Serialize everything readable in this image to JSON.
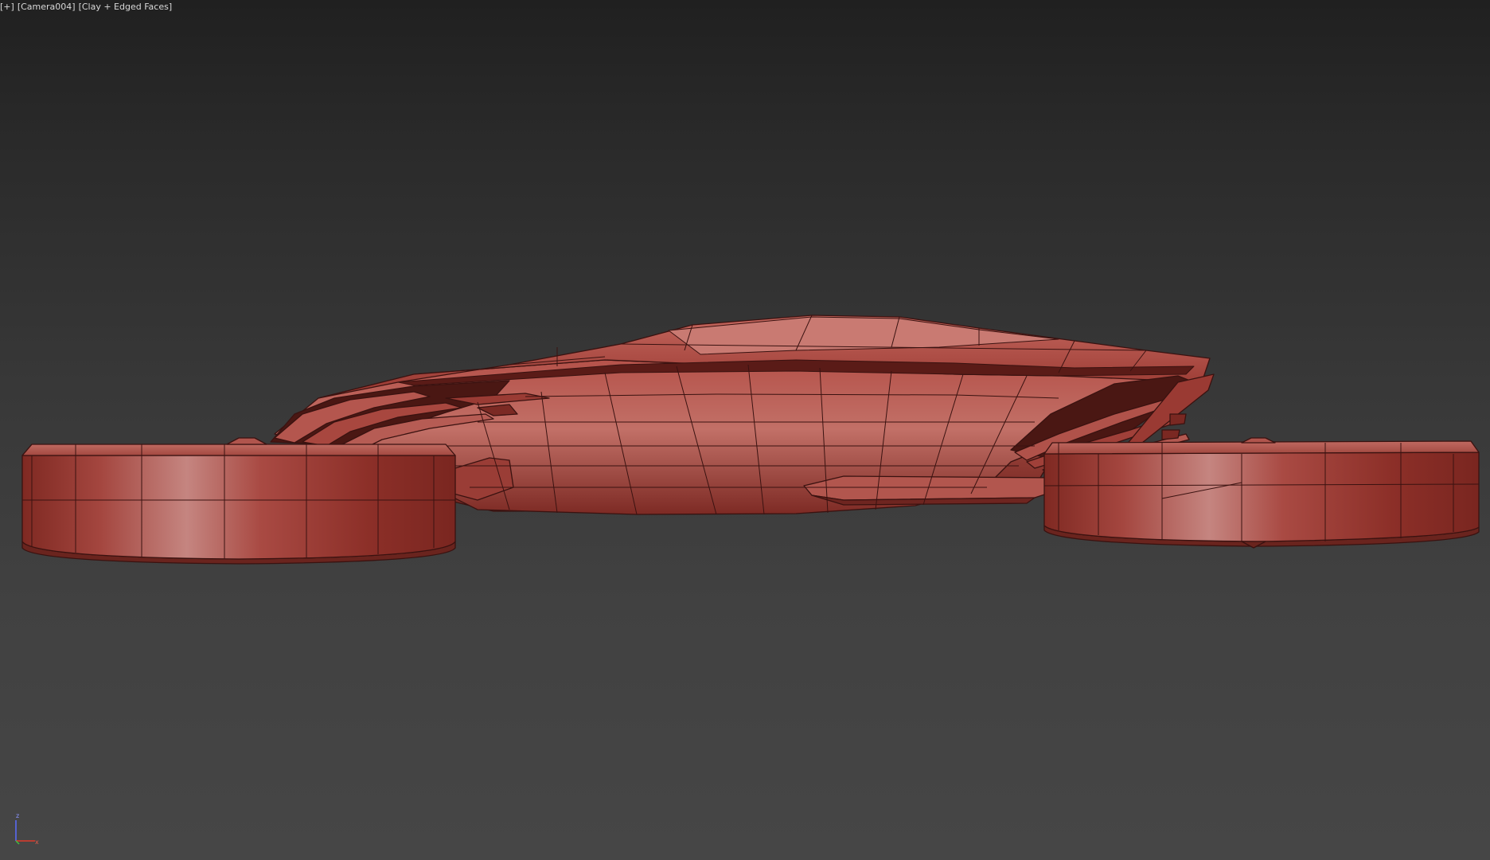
{
  "viewport": {
    "label_parts": [
      "[+]",
      "[Camera004]",
      "[Clay + Edged Faces]"
    ]
  },
  "axis_tripod": {
    "z_label": "z",
    "x_label": "x",
    "colors": {
      "z": "#5b6cff",
      "x": "#e03a2a",
      "y": "#3fbf3f"
    }
  },
  "model": {
    "shading": "clay-edged-faces",
    "colors": {
      "base": "#a5433c",
      "dark": "#6e2722",
      "light": "#c9807a",
      "wire": "#3a1210"
    }
  }
}
